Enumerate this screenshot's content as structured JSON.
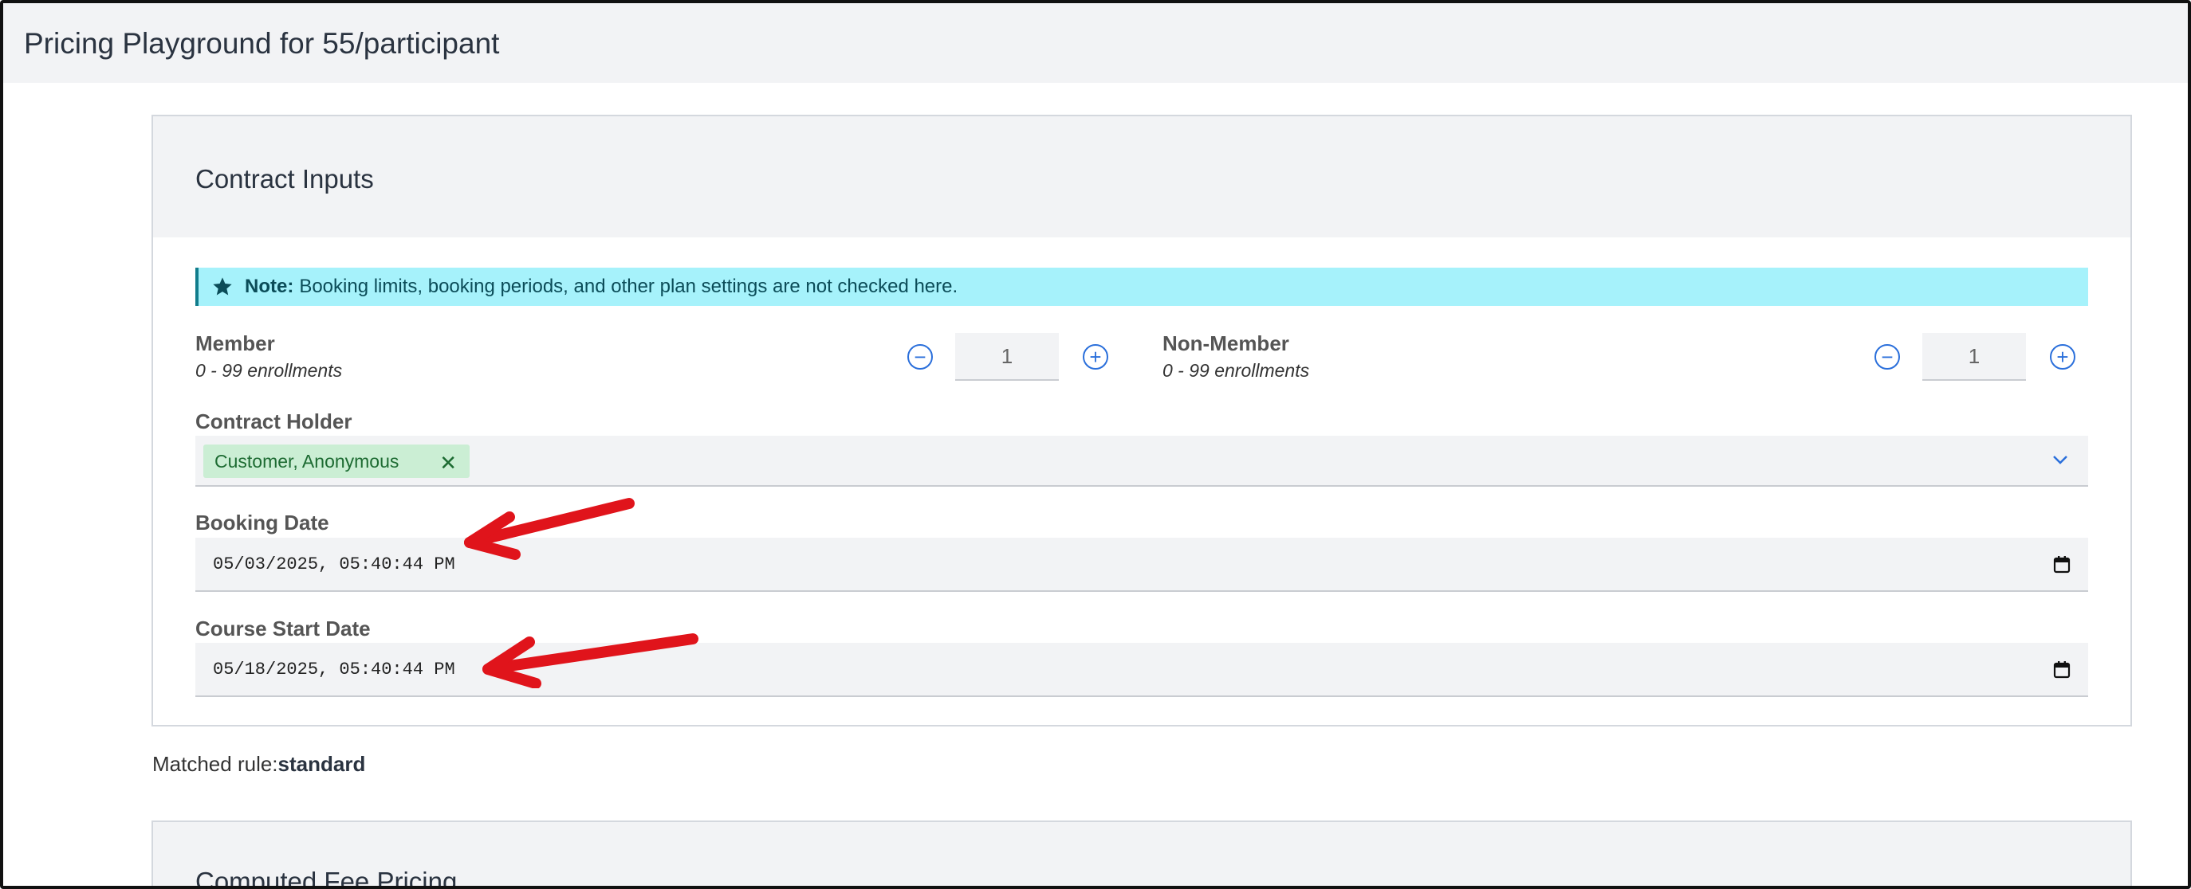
{
  "page": {
    "title": "Pricing Playground for 55/participant"
  },
  "contract_inputs": {
    "title": "Contract Inputs",
    "note": {
      "label": "Note:",
      "text": "Booking limits, booking periods, and other plan settings are not checked here.",
      "icon": "star-icon"
    },
    "member": {
      "label": "Member",
      "range": "0 - 99 enrollments",
      "value": "1",
      "decrement_icon": "minus-circle-icon",
      "increment_icon": "plus-circle-icon"
    },
    "non_member": {
      "label": "Non-Member",
      "range": "0 - 99 enrollments",
      "value": "1",
      "decrement_icon": "minus-circle-icon",
      "increment_icon": "plus-circle-icon"
    },
    "contract_holder": {
      "label": "Contract Holder",
      "selected_tag": "Customer, Anonymous",
      "remove_symbol": "✕"
    },
    "booking_date": {
      "label": "Booking Date",
      "value": "05/03/2025, 05:40:44 PM"
    },
    "course_start_date": {
      "label": "Course Start Date",
      "value": "05/18/2025, 05:40:44 PM"
    }
  },
  "matched_rule": {
    "label": "Matched rule:",
    "value": "standard"
  },
  "computed_fee_pricing": {
    "title": "Computed Fee Pricing"
  },
  "colors": {
    "accent_blue": "#2a6fdb",
    "note_background": "#a6f2fb",
    "tag_background": "#cbeed4",
    "annotation_red": "#e0141b"
  }
}
